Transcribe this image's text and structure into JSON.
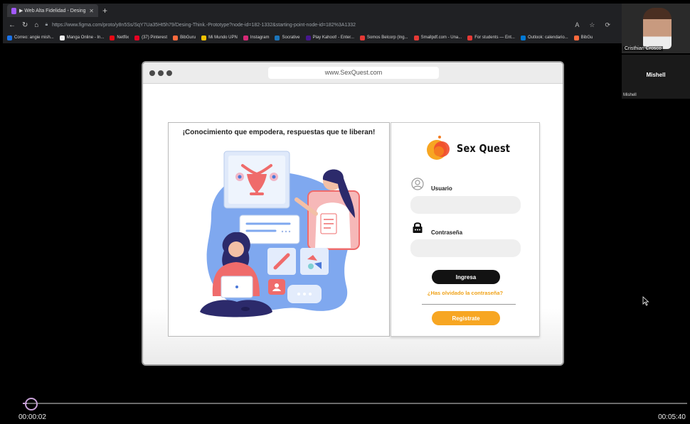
{
  "browser": {
    "tab_title": "▶ Web Alta Fidelidad - Desing",
    "address": "https://www.figma.com/proto/y8n5Ss/SqY7Ua35Ht5h79/Desing-Think.-Prototype?node-id=182-1332&starting-point-node-id=182%3A1332",
    "address_host": "www.figma.com",
    "bookmarks": [
      {
        "label": "Correo: angie mish...",
        "color": "#1a73e8"
      },
      {
        "label": "Manga Online - In...",
        "color": "#eeeeee"
      },
      {
        "label": "Netflix",
        "color": "#e50914"
      },
      {
        "label": "(37) Pinterest",
        "color": "#e60023"
      },
      {
        "label": "BibGuru",
        "color": "#ff6a3d"
      },
      {
        "label": "Mi Mundo UPN",
        "color": "#f2c200"
      },
      {
        "label": "Instagram",
        "color": "#d62976"
      },
      {
        "label": "Socrative",
        "color": "#1b75bb"
      },
      {
        "label": "Play Kahoot! - Enter...",
        "color": "#46178f"
      },
      {
        "label": "Somos Belcorp (Ing...",
        "color": "#e53935"
      },
      {
        "label": "Smallpdf.com - Una...",
        "color": "#e53935"
      },
      {
        "label": "For students — Ent...",
        "color": "#e53935"
      },
      {
        "label": "Outlook: calendario...",
        "color": "#0078d4"
      },
      {
        "label": "BibGu",
        "color": "#ff6a3d"
      }
    ]
  },
  "participants": [
    {
      "name": "Cristhian Crosco"
    },
    {
      "name": "Mishell",
      "center_label": "Mishell"
    }
  ],
  "prototype": {
    "url": "www.SexQuest.com",
    "headline": "¡Conocimiento que empodera, respuestas que te liberan!",
    "brand": "Sex Quest",
    "username_label": "Usuario",
    "username_value": "",
    "password_label": "Contraseña",
    "password_value": "",
    "login_button": "Ingresa",
    "forgot_link": "¿Has olvidado la contraseña?",
    "register_button": "Registrate",
    "colors": {
      "accent": "#f7a622",
      "dark_button": "#121212",
      "illus_blue": "#7fa8ef",
      "illus_coral": "#ef6b6b"
    }
  },
  "player": {
    "current_time": "00:00:02",
    "total_time": "00:05:40",
    "progress": 0.006,
    "accent": "#c7a0d6"
  }
}
